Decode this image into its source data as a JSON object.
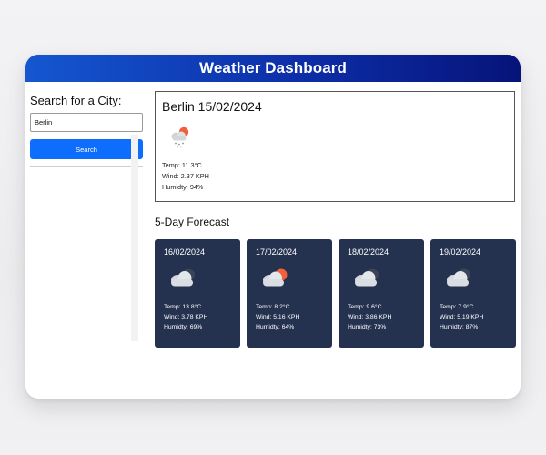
{
  "header": {
    "title": "Weather Dashboard"
  },
  "search": {
    "heading": "Search for a City:",
    "input_value": "Berlin",
    "button_label": "Search"
  },
  "current": {
    "title": "Berlin 15/02/2024",
    "icon": "rain-cloud-sun-icon",
    "temp": "Temp: 11.3°C",
    "wind": "Wind: 2.37 KPH",
    "humidity": "Humidty: 94%"
  },
  "forecast": {
    "heading": "5-Day Forecast",
    "days": [
      {
        "date": "16/02/2024",
        "icon": "cloud-icon",
        "temp": "Temp: 13.8°C",
        "wind": "Wind: 3.78 KPH",
        "humidity": "Humidty: 69%"
      },
      {
        "date": "17/02/2024",
        "icon": "cloud-sun-icon",
        "temp": "Temp: 8.2°C",
        "wind": "Wind: 5.16 KPH",
        "humidity": "Humidty: 64%"
      },
      {
        "date": "18/02/2024",
        "icon": "cloud-icon",
        "temp": "Temp: 9.6°C",
        "wind": "Wind: 3.86 KPH",
        "humidity": "Humidty: 73%"
      },
      {
        "date": "19/02/2024",
        "icon": "cloud-icon",
        "temp": "Temp: 7.9°C",
        "wind": "Wind: 5.19 KPH",
        "humidity": "Humidty: 87%"
      }
    ]
  },
  "colors": {
    "header_gradient_start": "#1457d0",
    "header_gradient_end": "#06147a",
    "search_button": "#0d6efd",
    "card_background": "#25324f",
    "sun": "#f0603a"
  }
}
